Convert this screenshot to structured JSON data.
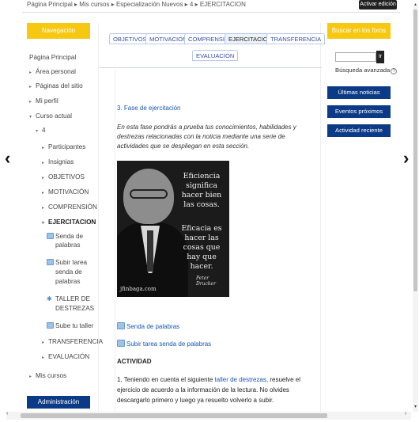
{
  "header": {
    "breadcrumb": "Página Principal ▸ Mis cursos ▸ Especialización Nuevos ▸ 4 ▸ EJERCITACION",
    "edit_button": "Activar edición"
  },
  "navigation": {
    "title": "Navegación",
    "items": [
      {
        "label": "Página Principal",
        "marker": ""
      },
      {
        "label": "Área personal",
        "marker": "▸"
      },
      {
        "label": "Páginas del sitio",
        "marker": "▸"
      },
      {
        "label": "Mi perfil",
        "marker": "▸"
      },
      {
        "label": "Curso actual",
        "marker": "▾"
      },
      {
        "label": "4",
        "marker": "▾"
      },
      {
        "label": "Participantes",
        "marker": "▸"
      },
      {
        "label": "Insignias",
        "marker": "▸"
      },
      {
        "label": "OBJETIVOS",
        "marker": "▸"
      },
      {
        "label": "MOTIVACIÓN",
        "marker": "▸"
      },
      {
        "label": "COMPRENSIÓN",
        "marker": "▸"
      },
      {
        "label": "EJERCITACION",
        "marker": "▾"
      },
      {
        "label": "Senda de",
        "marker": ""
      },
      {
        "label": "palabras",
        "marker": ""
      },
      {
        "label": "Subir tarea",
        "marker": ""
      },
      {
        "label": "senda de",
        "marker": ""
      },
      {
        "label": "palabras",
        "marker": ""
      },
      {
        "label": "TALLER DE",
        "marker": ""
      },
      {
        "label": "DESTREZAS",
        "marker": ""
      },
      {
        "label": "Sube tu taller",
        "marker": ""
      },
      {
        "label": "TRANSFERENCIA",
        "marker": "▸"
      },
      {
        "label": "EVALUACIÓN",
        "marker": "▸"
      },
      {
        "label": "Mis cursos",
        "marker": "▸"
      }
    ]
  },
  "admin": {
    "title": "Administración"
  },
  "tabs": [
    "OBJETIVOS",
    "MOTIVACIÓN",
    "COMPRENSIÓN",
    "EJERCITACION",
    "TRANSFERENCIA",
    "EVALUACIÓN"
  ],
  "content": {
    "section_title": "3. Fase de ejercitación",
    "intro": "En esta fase pondrás a prueba tus conocimientos, habilidades y destrezas relacionadas con la noticia mediante una serie de actividades que se despliegan en esta sección.",
    "poster": {
      "quote_1": "Eficiencia significa hacer bien las cosas.",
      "quote_2": "Eficacia es hacer las cosas que hay que hacer.",
      "author": "Peter Drucker",
      "site": "jfinbaga.com"
    },
    "links": [
      "Senda de palabras",
      "Subir tarea senda de palabras"
    ],
    "activity_heading": "ACTIVIDAD",
    "activity_text_before": "1. Teniendo en cuenta el siguiente ",
    "activity_link": "taller de destrezas",
    "activity_text_after": ", resuelve el ejercicio de acuerdo a la información de la lectura. No olvides descargarlo primero y luego ya resuelto volverlo a subir."
  },
  "search_block": {
    "title": "Buscar en los foros",
    "go": "Ir",
    "advanced": "Búsqueda avanzada"
  },
  "right_buttons": [
    "Últimas noticias",
    "Eventos próximos",
    "Actividad reciente"
  ],
  "colors": {
    "accent_yellow": "#f6c812",
    "nav_blue": "#0b3a86",
    "link_blue": "#1a56b0"
  }
}
